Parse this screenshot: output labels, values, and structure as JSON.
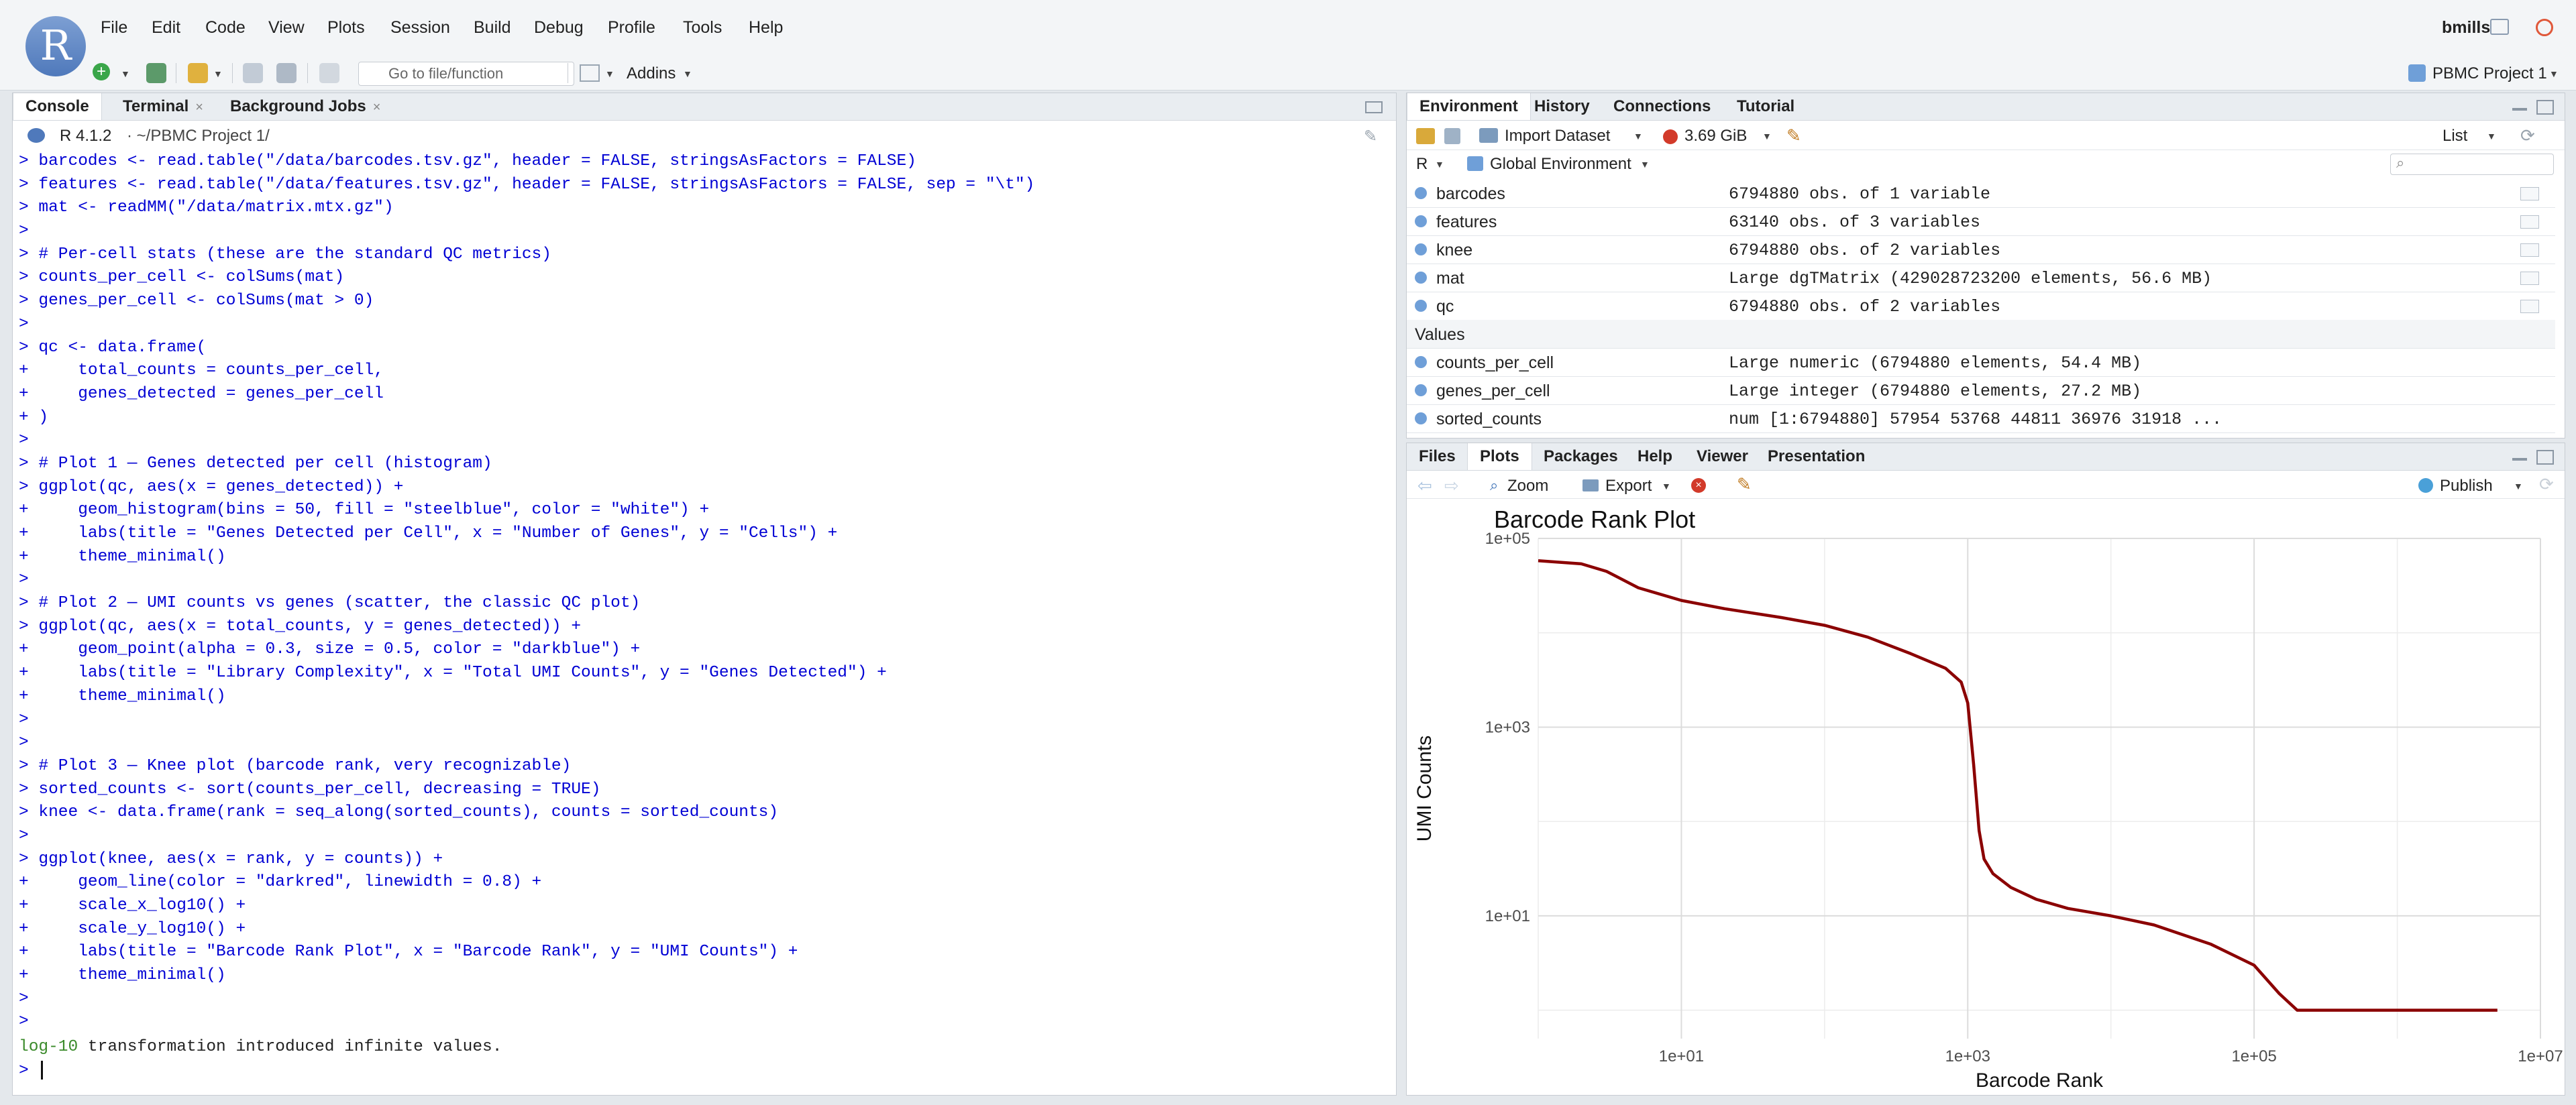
{
  "menubar": {
    "logo": "R",
    "items": [
      "File",
      "Edit",
      "Code",
      "View",
      "Plots",
      "Session",
      "Build",
      "Debug",
      "Profile",
      "Tools",
      "Help"
    ],
    "user": "bmills"
  },
  "toolbar": {
    "goto_placeholder": "Go to file/function",
    "addins_label": "Addins",
    "project_label": "PBMC Project 1"
  },
  "console": {
    "tabs": [
      "Console",
      "Terminal",
      "Background Jobs"
    ],
    "r_version": "R 4.1.2",
    "path": "· ~/PBMC Project 1/",
    "lines": [
      "> barcodes <- read.table(\"/data/barcodes.tsv.gz\", header = FALSE, stringsAsFactors = FALSE)",
      "> features <- read.table(\"/data/features.tsv.gz\", header = FALSE, stringsAsFactors = FALSE, sep = \"\\t\")",
      "> mat <- readMM(\"/data/matrix.mtx.gz\")",
      ">",
      "> # Per-cell stats (these are the standard QC metrics)",
      "> counts_per_cell <- colSums(mat)",
      "> genes_per_cell <- colSums(mat > 0)",
      ">",
      "> qc <- data.frame(",
      "+     total_counts = counts_per_cell,",
      "+     genes_detected = genes_per_cell",
      "+ )",
      ">",
      "> # Plot 1 — Genes detected per cell (histogram)",
      "> ggplot(qc, aes(x = genes_detected)) +",
      "+     geom_histogram(bins = 50, fill = \"steelblue\", color = \"white\") +",
      "+     labs(title = \"Genes Detected per Cell\", x = \"Number of Genes\", y = \"Cells\") +",
      "+     theme_minimal()",
      ">",
      "> # Plot 2 — UMI counts vs genes (scatter, the classic QC plot)",
      "> ggplot(qc, aes(x = total_counts, y = genes_detected)) +",
      "+     geom_point(alpha = 0.3, size = 0.5, color = \"darkblue\") +",
      "+     labs(title = \"Library Complexity\", x = \"Total UMI Counts\", y = \"Genes Detected\") +",
      "+     theme_minimal()",
      ">",
      ">",
      "> # Plot 3 — Knee plot (barcode rank, very recognizable)",
      "> sorted_counts <- sort(counts_per_cell, decreasing = TRUE)",
      "> knee <- data.frame(rank = seq_along(sorted_counts), counts = sorted_counts)",
      ">",
      "> ggplot(knee, aes(x = rank, y = counts)) +",
      "+     geom_line(color = \"darkred\", linewidth = 0.8) +",
      "+     scale_x_log10() +",
      "+     scale_y_log10() +",
      "+     labs(title = \"Barcode Rank Plot\", x = \"Barcode Rank\", y = \"UMI Counts\") +",
      "+     theme_minimal()",
      ">",
      ">"
    ],
    "warning_prefix": "log-10",
    "warning_text": " transformation introduced infinite values.",
    "prompt": ">"
  },
  "environment": {
    "tabs": [
      "Environment",
      "History",
      "Connections",
      "Tutorial"
    ],
    "import_label": "Import Dataset",
    "memory_label": "3.69 GiB",
    "list_label": "List",
    "lang_label": "R",
    "scope_label": "Global Environment",
    "data_rows": [
      {
        "name": "barcodes",
        "value": "6794880 obs. of 1 variable"
      },
      {
        "name": "features",
        "value": "63140 obs. of 3 variables"
      },
      {
        "name": "knee",
        "value": "6794880 obs. of 2 variables"
      },
      {
        "name": "mat",
        "value": "Large dgTMatrix (429028723200 elements,  56.6 MB)"
      },
      {
        "name": "qc",
        "value": "6794880 obs. of 2 variables"
      }
    ],
    "values_header": "Values",
    "value_rows": [
      {
        "name": "counts_per_cell",
        "value": "Large numeric (6794880 elements,  54.4 MB)"
      },
      {
        "name": "genes_per_cell",
        "value": "Large integer (6794880 elements,  27.2 MB)"
      },
      {
        "name": "sorted_counts",
        "value": "num [1:6794880] 57954 53768 44811 36976 31918 ..."
      }
    ]
  },
  "plots_pane": {
    "tabs": [
      "Files",
      "Plots",
      "Packages",
      "Help",
      "Viewer",
      "Presentation"
    ],
    "zoom_label": "Zoom",
    "export_label": "Export",
    "publish_label": "Publish"
  },
  "chart_data": {
    "type": "line",
    "title": "Barcode Rank Plot",
    "xlabel": "Barcode Rank",
    "ylabel": "UMI Counts",
    "x_scale": "log10",
    "y_scale": "log10",
    "xlim": [
      1,
      10000000
    ],
    "ylim": [
      0.5,
      100000
    ],
    "x_ticks": [
      "1e+01",
      "1e+03",
      "1e+05",
      "1e+07"
    ],
    "y_ticks": [
      "1e+01",
      "1e+03",
      "1e+05"
    ],
    "grid": true,
    "series": [
      {
        "color": "#8b0000",
        "x": [
          1,
          2,
          3,
          5,
          10,
          20,
          50,
          100,
          200,
          400,
          700,
          900,
          1000,
          1100,
          1200,
          1300,
          1500,
          2000,
          3000,
          5000,
          10000,
          20000,
          50000,
          100000,
          150000,
          200000,
          300000,
          5000000
        ],
        "y": [
          57954,
          53768,
          44811,
          30000,
          22000,
          18000,
          14500,
          12000,
          9000,
          6000,
          4200,
          3000,
          1800,
          400,
          80,
          40,
          28,
          20,
          15,
          12,
          10,
          8,
          5,
          3,
          1.5,
          1,
          1,
          1
        ]
      }
    ]
  }
}
